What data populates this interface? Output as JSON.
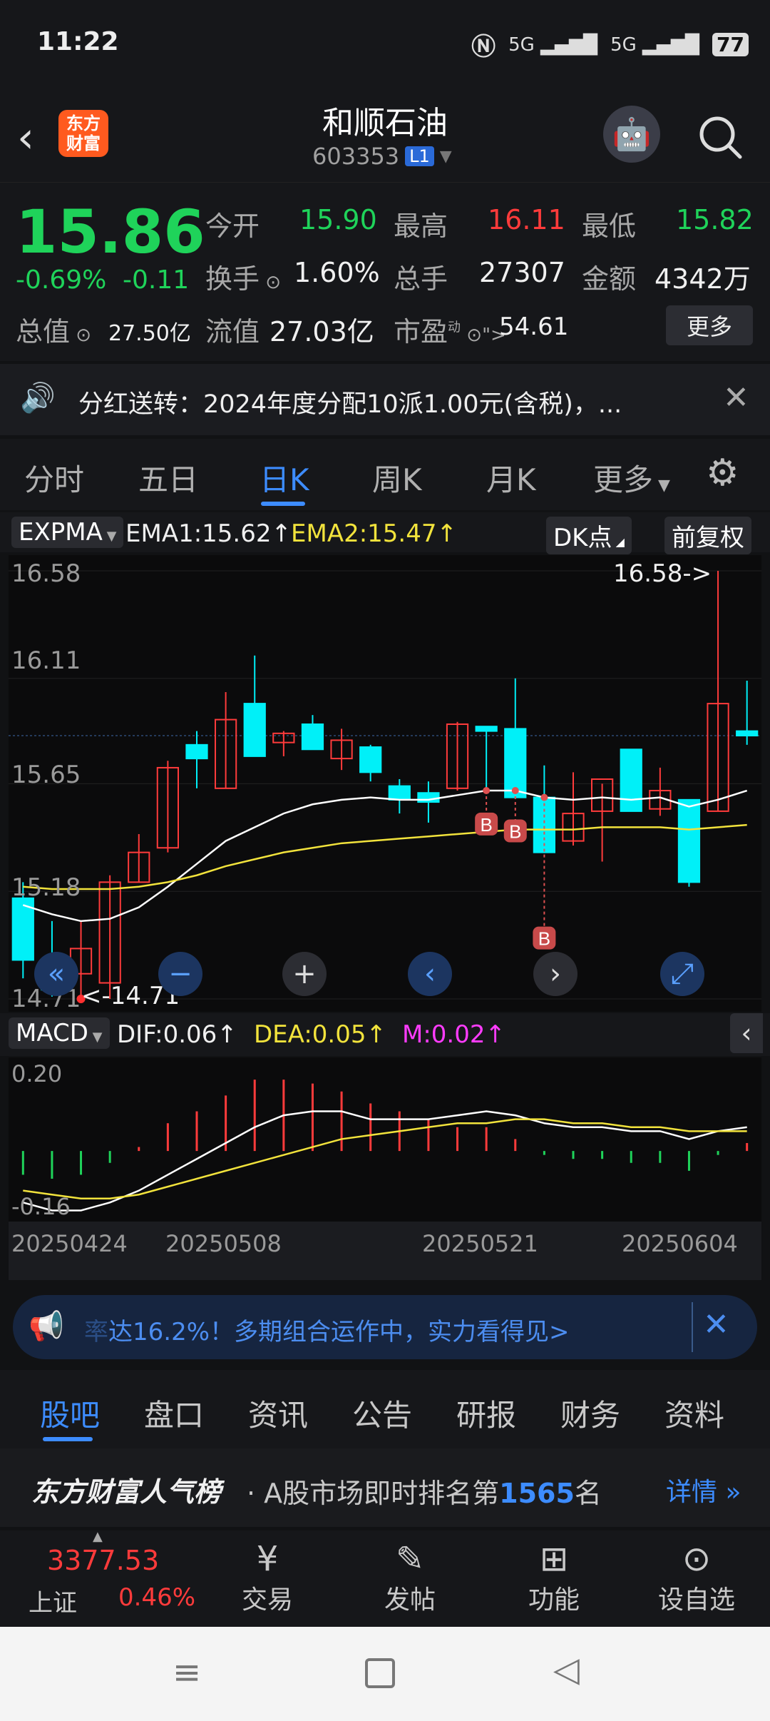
{
  "status_bar": {
    "time": "11:22",
    "signal1": "5G",
    "signal2": "5G",
    "battery": "77"
  },
  "header": {
    "title": "和顺石油",
    "code": "603353",
    "level": "L1",
    "logo_top": "东方",
    "logo_bottom": "财富"
  },
  "quote": {
    "price": "15.86",
    "change_pct": "-0.69%",
    "change": "-0.11",
    "open_label": "今开",
    "open": "15.90",
    "high_label": "最高",
    "high": "16.11",
    "low_label": "最低",
    "low": "15.82",
    "turnover_label": "换手",
    "turnover": "1.60%",
    "volume_label": "总手",
    "volume": "27307",
    "amount_label": "金额",
    "amount": "4342万",
    "mktcap_label": "总值",
    "mktcap": "27.50亿",
    "float_label": "流值",
    "float": "27.03亿",
    "pe_label": "市盈",
    "pe_sup": "动",
    "pe": "54.61",
    "more_button": "更多"
  },
  "notice": {
    "text": "分红送转：2024年度分配10派1.00元(含税)，..."
  },
  "tabs": [
    "分时",
    "五日",
    "日K",
    "周K",
    "月K",
    "更多"
  ],
  "active_tab": "日K",
  "chart_bar": {
    "indicator": "EXPMA",
    "ema1": "EMA1:15.62↑",
    "ema2": "EMA2:15.47↑",
    "dk_button": "DK点",
    "adjust_button": "前复权"
  },
  "colors": {
    "up": "#ff3b3b",
    "down": "#00f0f8",
    "ema1": "#ffffff",
    "ema2": "#f2e33c",
    "accent": "#3d8cff"
  },
  "chart_data": [
    {
      "type": "candlestick",
      "y_ticks": [
        "16.58",
        "16.11",
        "15.65",
        "15.18",
        "14.71"
      ],
      "ylim": [
        14.71,
        16.58
      ],
      "max_label": "16.58->",
      "min_label": "<-14.71",
      "candles": [
        {
          "o": 15.15,
          "h": 15.22,
          "l": 14.8,
          "c": 14.88
        },
        {
          "o": 14.88,
          "h": 15.05,
          "l": 14.72,
          "c": 14.75
        },
        {
          "o": 14.82,
          "h": 15.05,
          "l": 14.71,
          "c": 14.93
        },
        {
          "o": 14.78,
          "h": 15.25,
          "l": 14.71,
          "c": 15.22
        },
        {
          "o": 15.22,
          "h": 15.43,
          "l": 15.22,
          "c": 15.35
        },
        {
          "o": 15.37,
          "h": 15.75,
          "l": 15.35,
          "c": 15.72
        },
        {
          "o": 15.82,
          "h": 15.88,
          "l": 15.63,
          "c": 15.76
        },
        {
          "o": 15.63,
          "h": 16.05,
          "l": 15.63,
          "c": 15.93
        },
        {
          "o": 16.0,
          "h": 16.21,
          "l": 15.78,
          "c": 15.77
        },
        {
          "o": 15.83,
          "h": 15.88,
          "l": 15.77,
          "c": 15.87
        },
        {
          "o": 15.91,
          "h": 15.95,
          "l": 15.81,
          "c": 15.8
        },
        {
          "o": 15.76,
          "h": 15.89,
          "l": 15.71,
          "c": 15.84
        },
        {
          "o": 15.81,
          "h": 15.82,
          "l": 15.66,
          "c": 15.7
        },
        {
          "o": 15.64,
          "h": 15.67,
          "l": 15.52,
          "c": 15.58
        },
        {
          "o": 15.61,
          "h": 15.66,
          "l": 15.48,
          "c": 15.57
        },
        {
          "o": 15.63,
          "h": 15.92,
          "l": 15.62,
          "c": 15.91
        },
        {
          "o": 15.9,
          "h": 15.9,
          "l": 15.63,
          "c": 15.88
        },
        {
          "o": 15.89,
          "h": 16.11,
          "l": 15.6,
          "c": 15.59
        },
        {
          "o": 15.59,
          "h": 15.73,
          "l": 15.35,
          "c": 15.35
        },
        {
          "o": 15.4,
          "h": 15.7,
          "l": 15.38,
          "c": 15.52
        },
        {
          "o": 15.53,
          "h": 15.65,
          "l": 15.31,
          "c": 15.67
        },
        {
          "o": 15.8,
          "h": 15.8,
          "l": 15.55,
          "c": 15.53
        },
        {
          "o": 15.54,
          "h": 15.72,
          "l": 15.51,
          "c": 15.62
        },
        {
          "o": 15.58,
          "h": 15.55,
          "l": 15.2,
          "c": 15.22
        },
        {
          "o": 15.53,
          "h": 16.58,
          "l": 15.53,
          "c": 16.0
        },
        {
          "o": 15.88,
          "h": 16.1,
          "l": 15.82,
          "c": 15.86
        }
      ],
      "ema1": [
        15.12,
        15.08,
        15.05,
        15.06,
        15.11,
        15.2,
        15.3,
        15.4,
        15.46,
        15.52,
        15.56,
        15.58,
        15.59,
        15.58,
        15.58,
        15.6,
        15.62,
        15.62,
        15.59,
        15.58,
        15.59,
        15.58,
        15.59,
        15.55,
        15.58,
        15.62
      ],
      "ema2": [
        15.2,
        15.19,
        15.19,
        15.19,
        15.2,
        15.22,
        15.25,
        15.29,
        15.32,
        15.35,
        15.37,
        15.39,
        15.4,
        15.41,
        15.42,
        15.43,
        15.44,
        15.45,
        15.45,
        15.45,
        15.46,
        15.46,
        15.46,
        15.45,
        15.46,
        15.47
      ],
      "buy_markers": [
        16,
        17,
        18
      ],
      "buy_label": "B"
    },
    {
      "type": "macd",
      "y_ticks": [
        "0.20",
        "-0.16"
      ],
      "ylim": [
        -0.16,
        0.2
      ],
      "hist": [
        -0.06,
        -0.07,
        -0.06,
        -0.03,
        0.01,
        0.07,
        0.1,
        0.14,
        0.18,
        0.18,
        0.17,
        0.15,
        0.12,
        0.1,
        0.08,
        0.06,
        0.06,
        0.03,
        -0.01,
        -0.02,
        -0.02,
        -0.03,
        -0.03,
        -0.05,
        -0.01,
        0.02
      ],
      "dif": [
        -0.13,
        -0.15,
        -0.15,
        -0.13,
        -0.1,
        -0.06,
        -0.02,
        0.02,
        0.06,
        0.09,
        0.1,
        0.1,
        0.08,
        0.08,
        0.08,
        0.09,
        0.1,
        0.09,
        0.07,
        0.06,
        0.06,
        0.05,
        0.05,
        0.03,
        0.05,
        0.06
      ],
      "dea": [
        -0.1,
        -0.11,
        -0.12,
        -0.12,
        -0.11,
        -0.09,
        -0.07,
        -0.05,
        -0.03,
        -0.01,
        0.01,
        0.03,
        0.04,
        0.05,
        0.06,
        0.07,
        0.07,
        0.08,
        0.08,
        0.07,
        0.07,
        0.06,
        0.06,
        0.05,
        0.05,
        0.05
      ]
    }
  ],
  "macd_bar": {
    "indicator": "MACD",
    "dif": "DIF:0.06↑",
    "dea": "DEA:0.05↑",
    "m": "M:0.02↑"
  },
  "dates": [
    "20250424",
    "20250508",
    "20250521",
    "20250604"
  ],
  "ad": {
    "text": "达16.2%！多期组合运作中，实力看得见>",
    "prefix": "率"
  },
  "sub_tabs": [
    "股吧",
    "盘口",
    "资讯",
    "公告",
    "研报",
    "财务",
    "资料"
  ],
  "active_sub_tab": "股吧",
  "rank": {
    "brand": "东方财富人气榜",
    "text_before": "· A股市场即时排名第",
    "rank": "1565",
    "text_after": "名",
    "detail": "详情"
  },
  "bottom_nav": {
    "index_value": "3377.53",
    "index_name": "上证",
    "index_change": "0.46%",
    "items": [
      "交易",
      "发帖",
      "功能",
      "设自选"
    ]
  }
}
